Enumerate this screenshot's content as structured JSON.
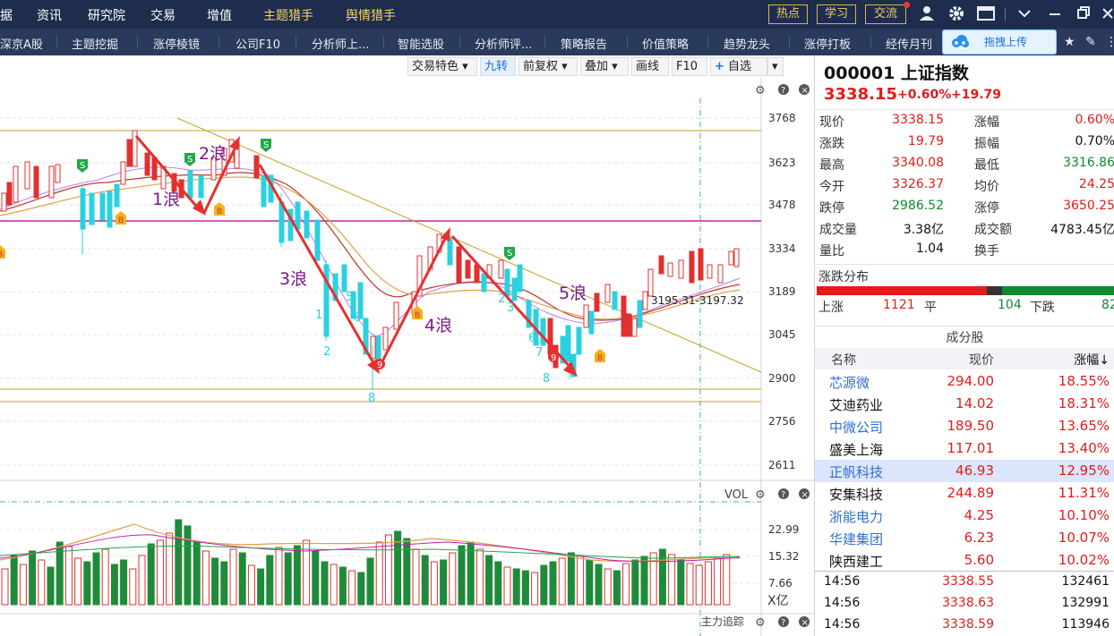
{
  "topbar": {
    "items": [
      "据",
      "资讯",
      "研究院",
      "交易",
      "增值",
      "主题猎手",
      "舆情猎手"
    ],
    "buttons": [
      "热点",
      "学习",
      "交流"
    ]
  },
  "nav2": {
    "items": [
      "深京A股",
      "主题挖掘",
      "涨停棱镜",
      "公司F10",
      "分析师上...",
      "智能选股",
      "分析师评...",
      "策略报告",
      "价值策略",
      "趋势龙头",
      "涨停打板",
      "经传月刊"
    ],
    "upload": "拖拽上传"
  },
  "toolbar": [
    "交易特色",
    "九转",
    "前复权",
    "叠加",
    "画线",
    "F10",
    "自选"
  ],
  "chart": {
    "y_ticks": [
      "3768",
      "3623",
      "3478",
      "3334",
      "3189",
      "3045",
      "2900",
      "2756",
      "2611"
    ],
    "vol_ticks": [
      "22.99",
      "15.32",
      "7.66",
      "X亿"
    ],
    "vol_label": "VOL",
    "footer_label": "主力追踪",
    "wave_labels": [
      "1浪",
      "2浪",
      "3浪",
      "4浪",
      "5浪"
    ],
    "annotation": "3195.31-3197.32",
    "td_numbers": [
      "1",
      "2",
      "5",
      "6",
      "8",
      "2",
      "3",
      "6",
      "7",
      "8",
      "9",
      "9"
    ],
    "signal_s": "S",
    "signal_b": "B"
  },
  "chart_data": {
    "type": "candlestick",
    "y_axis_ticks": [
      3768,
      3623,
      3478,
      3334,
      3189,
      3045,
      2900,
      2756,
      2611
    ],
    "volume_axis_ticks": [
      22.99,
      15.32,
      7.66
    ],
    "volume_unit": "X亿",
    "annotation": "3195.31-3197.32"
  },
  "quote": {
    "code": "000001 上证指数",
    "price": "3338.15",
    "pct": "+0.60%",
    "chg": "+19.79",
    "rows": [
      {
        "l1": "现价",
        "v1": "3338.15",
        "c1": "red",
        "l2": "涨幅",
        "v2": "0.60%",
        "c2": "red"
      },
      {
        "l1": "涨跌",
        "v1": "19.79",
        "c1": "red",
        "l2": "振幅",
        "v2": "0.70%",
        "c2": "blk"
      },
      {
        "l1": "最高",
        "v1": "3340.08",
        "c1": "red",
        "l2": "最低",
        "v2": "3316.86",
        "c2": "green"
      },
      {
        "l1": "今开",
        "v1": "3326.37",
        "c1": "red",
        "l2": "均价",
        "v2": "24.25",
        "c2": "red"
      },
      {
        "l1": "跌停",
        "v1": "2986.52",
        "c1": "green",
        "l2": "涨停",
        "v2": "3650.25",
        "c2": "red"
      },
      {
        "l1": "成交量",
        "v1": "3.38亿",
        "c1": "blk",
        "l2": "成交额",
        "v2": "4783.45亿",
        "c2": "blk"
      },
      {
        "l1": "量比",
        "v1": "1.04",
        "c1": "blk",
        "l2": "换手",
        "v2": "",
        "c2": "blk"
      }
    ],
    "dist_title": "涨跌分布",
    "up_label": "上涨",
    "up": "1121",
    "flat_label": "平",
    "flat": "104",
    "down_label": "下跌",
    "down": "82",
    "up_fraction": 0.57,
    "flat_fraction": 0.053
  },
  "constituents": {
    "title": "成分股",
    "headers": [
      "名称",
      "现价",
      "涨幅↓"
    ],
    "rows": [
      {
        "name": "芯源微",
        "price": "294.00",
        "pct": "18.55%",
        "blue": true
      },
      {
        "name": "艾迪药业",
        "price": "14.02",
        "pct": "18.31%",
        "blue": false
      },
      {
        "name": "中微公司",
        "price": "189.50",
        "pct": "13.65%",
        "blue": true
      },
      {
        "name": "盛美上海",
        "price": "117.01",
        "pct": "13.40%",
        "blue": false
      },
      {
        "name": "正帆科技",
        "price": "46.93",
        "pct": "12.95%",
        "blue": true
      },
      {
        "name": "安集科技",
        "price": "244.89",
        "pct": "11.31%",
        "blue": false
      },
      {
        "name": "浙能电力",
        "price": "4.25",
        "pct": "10.10%",
        "blue": true
      },
      {
        "name": "华建集团",
        "price": "6.23",
        "pct": "10.07%",
        "blue": true
      },
      {
        "name": "陕西建工",
        "price": "5.60",
        "pct": "10.02%",
        "blue": false
      }
    ]
  },
  "ticks": [
    {
      "time": "14:56",
      "price": "3338.55",
      "vol": "132461"
    },
    {
      "time": "14:56",
      "price": "3338.63",
      "vol": "132991"
    },
    {
      "time": "14:56",
      "price": "3338.59",
      "vol": "113946"
    }
  ]
}
